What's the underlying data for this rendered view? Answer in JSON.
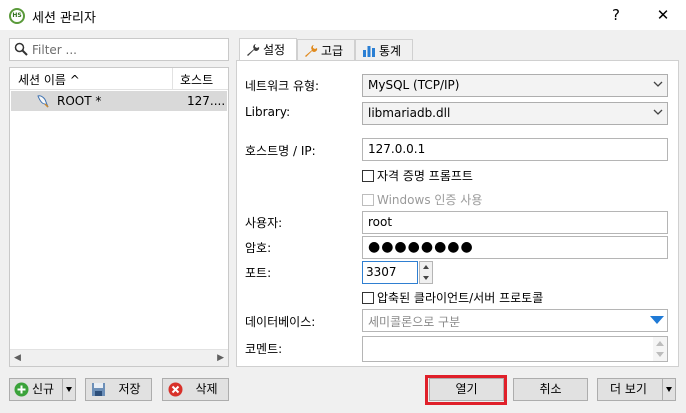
{
  "window": {
    "title": "세션 관리자",
    "help_glyph": "?",
    "close_glyph": "✕"
  },
  "filter": {
    "placeholder": "Filter ..."
  },
  "session_list": {
    "columns": [
      "세션 이름 ^",
      "호스트"
    ],
    "rows": [
      {
        "name": "ROOT *",
        "host": "127...."
      }
    ]
  },
  "tabs": [
    "설정",
    "고급",
    "통계"
  ],
  "form": {
    "network_type_label": "네트워크 유형:",
    "network_type_value": "MySQL (TCP/IP)",
    "library_label": "Library:",
    "library_value": "libmariadb.dll",
    "host_label": "호스트명 / IP:",
    "host_value": "127.0.0.1",
    "prompt_credentials_label": "자격 증명 프롬프트",
    "windows_auth_label": "Windows 인증 사용",
    "user_label": "사용자:",
    "user_value": "root",
    "password_label": "암호:",
    "password_value": "●●●●●●●●",
    "port_label": "포트:",
    "port_value": "3307",
    "compressed_label": "압축된 클라이언트/서버 프로토콜",
    "databases_label": "데이터베이스:",
    "databases_placeholder": "세미콜론으로 구분",
    "comment_label": "코멘트:"
  },
  "buttons": {
    "new": "신규",
    "save": "저장",
    "delete": "삭제",
    "open": "열기",
    "cancel": "취소",
    "more": "더 보기"
  },
  "colors": {
    "highlight": "#e0202a",
    "spin_focus": "#2f7fd1",
    "db_arrow": "#1f7ad6"
  }
}
